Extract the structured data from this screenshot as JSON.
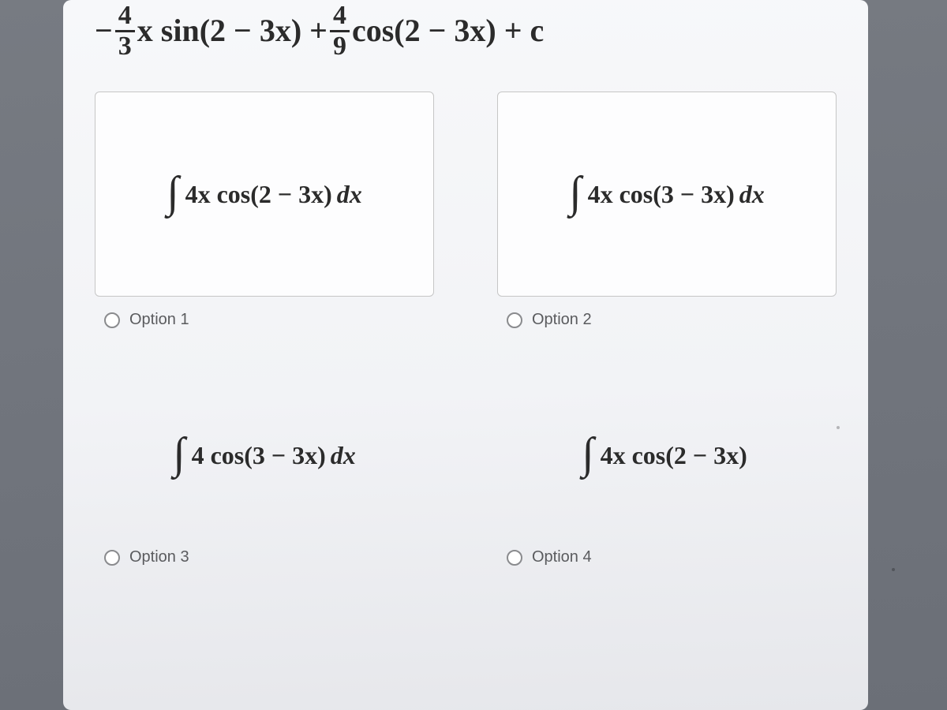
{
  "header": {
    "prefix_minus": "−",
    "frac1_num": "4",
    "frac1_den": "3",
    "mid1": "x sin(2 − 3x) + ",
    "frac2_num": "4",
    "frac2_den": "9",
    "mid2": "cos(2 − 3x) + c"
  },
  "options": [
    {
      "integral": "∫",
      "body": "4x cos(2 − 3x)",
      "dx": "dx",
      "label": "Option 1"
    },
    {
      "integral": "∫",
      "body": "4x cos(3 − 3x)",
      "dx": "dx",
      "label": "Option 2"
    },
    {
      "integral": "∫",
      "body": "4 cos(3 − 3x)",
      "dx": "dx",
      "label": "Option 3"
    },
    {
      "integral": "∫",
      "body": "4x cos(2 − 3x)",
      "dx": "",
      "label": "Option 4"
    }
  ]
}
